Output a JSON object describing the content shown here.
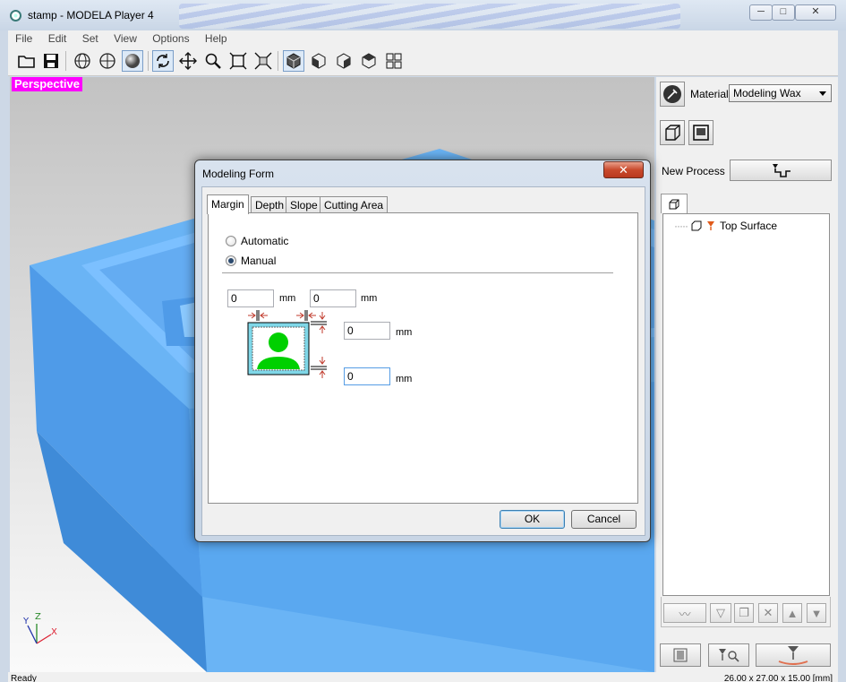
{
  "window": {
    "title": "stamp - MODELA Player 4",
    "minimize_glyph": "─",
    "maximize_glyph": "□",
    "close_glyph": "✕"
  },
  "menu": [
    "File",
    "Edit",
    "Set",
    "View",
    "Options",
    "Help"
  ],
  "toolbar": {
    "icons": [
      "open-file-icon",
      "save-icon",
      "wireframe-icon",
      "hidden-line-icon",
      "shaded-icon",
      "rotate-icon",
      "pan-icon",
      "zoom-icon",
      "fit-view-icon",
      "zoom-window-icon",
      "view-iso-icon",
      "view-front-icon",
      "view-right-icon",
      "view-left-icon",
      "view-multi-icon"
    ]
  },
  "viewport": {
    "view_label": "Perspective",
    "axis_y": "Y",
    "axis_z": "Z",
    "axis_x": "X",
    "model_color": "#5aa8f0"
  },
  "right_panel": {
    "material_label": "Material",
    "material_value": "Modeling Wax",
    "new_process_label": "New Process",
    "tree": [
      {
        "label": "Top Surface"
      }
    ]
  },
  "status": {
    "left": "Ready",
    "right": "26.00 x 27.00 x 15.00 [mm]"
  },
  "dialog": {
    "title": "Modeling Form",
    "close_glyph": "✕",
    "tabs": [
      "Margin",
      "Depth",
      "Slope",
      "Cutting Area"
    ],
    "active_tab": "Margin",
    "radio_automatic": "Automatic",
    "radio_manual": "Manual",
    "selected_mode": "Manual",
    "margin_left_value": "0",
    "margin_right_value": "0",
    "margin_top_value": "0",
    "margin_bottom_value": "0",
    "unit": "mm",
    "ok_label": "OK",
    "cancel_label": "Cancel"
  }
}
